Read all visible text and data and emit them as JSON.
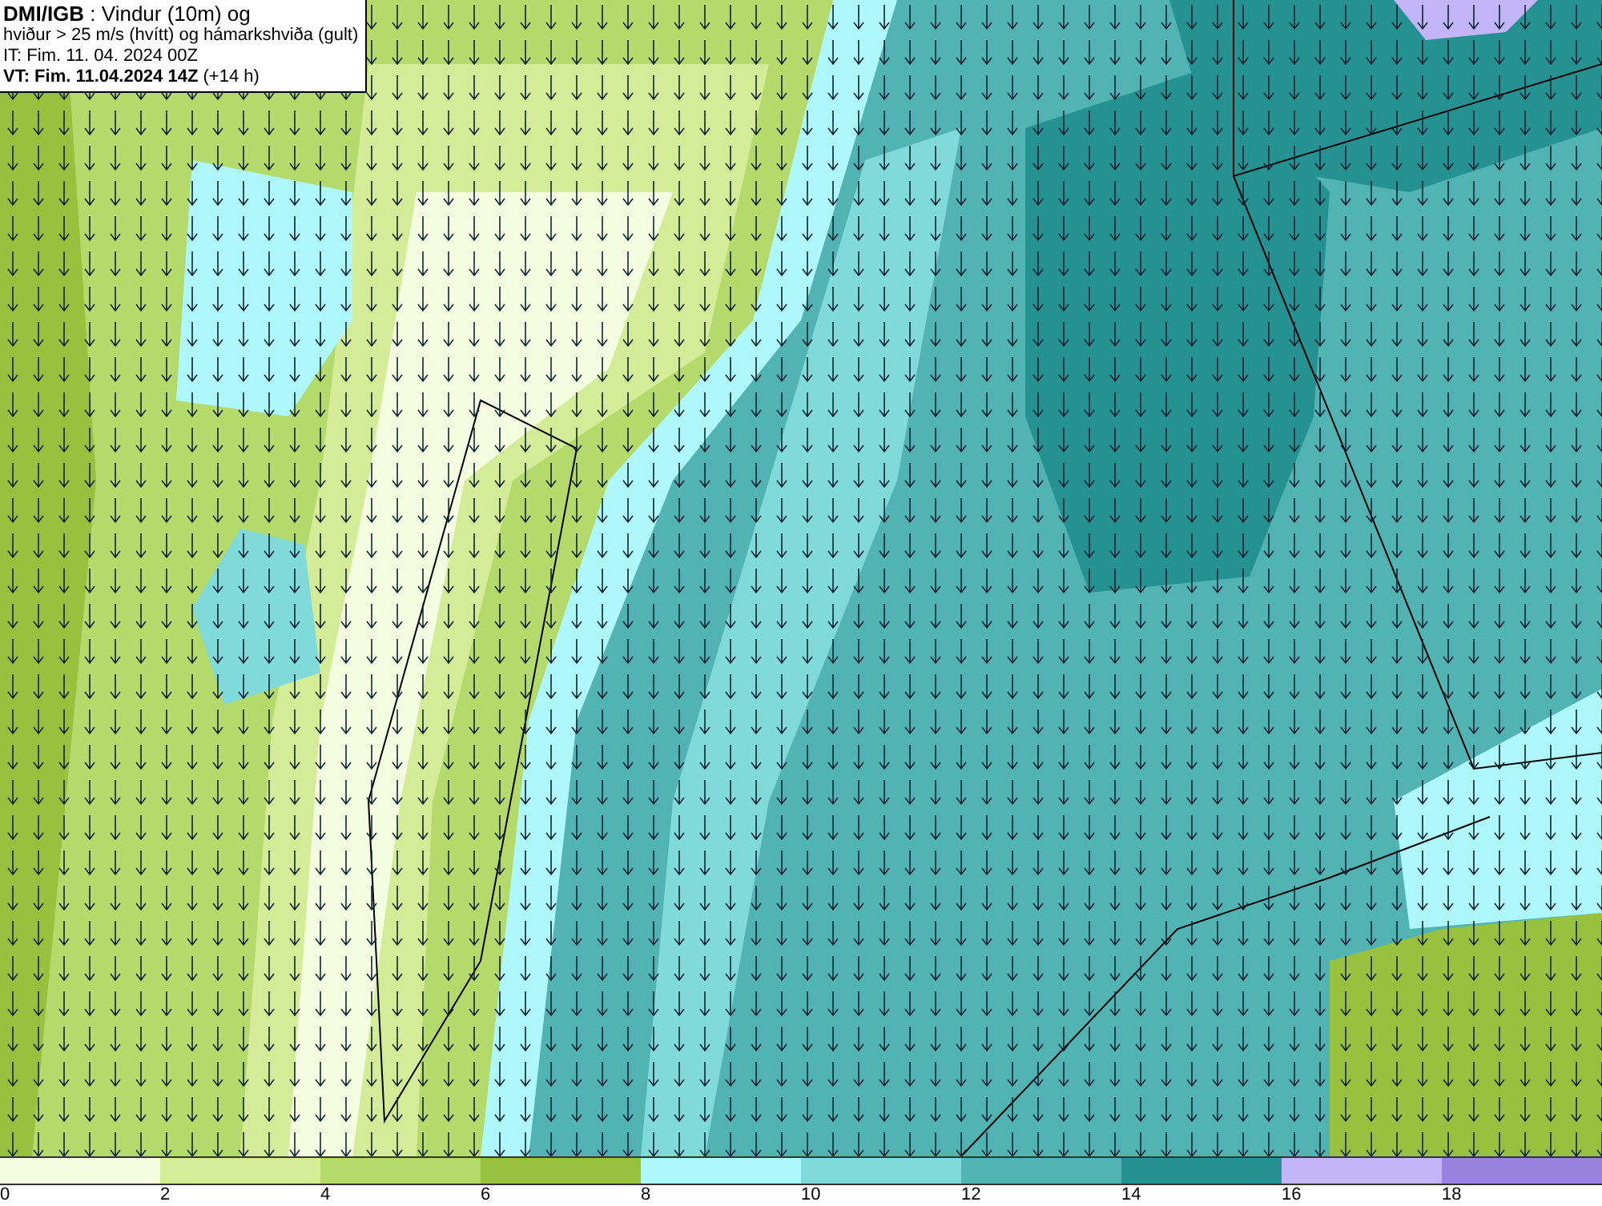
{
  "header": {
    "lines": [
      "**DMI/IGB** : Vindur (10m) og",
      "hviður > 25 m/s (hvítt) og hámarkshviða (gult)",
      "IT: Fim. 11. 04. 2024 00Z",
      "**VT: Fim. 11.04.2024 14Z** (+14 h)"
    ]
  },
  "legend": {
    "bins": [
      {
        "color": "#f4fde0"
      },
      {
        "color": "#d4ec98"
      },
      {
        "color": "#b4da6c"
      },
      {
        "color": "#98c23e"
      },
      {
        "color": "#aef8fb"
      },
      {
        "color": "#80dada"
      },
      {
        "color": "#52b3b3"
      },
      {
        "color": "#259191"
      },
      {
        "color": "#c2b6f8"
      },
      {
        "color": "#9a82e0"
      }
    ],
    "ticks": [
      "0",
      "2",
      "4",
      "6",
      "8",
      "10",
      "12",
      "14",
      "16",
      "18"
    ]
  }
}
